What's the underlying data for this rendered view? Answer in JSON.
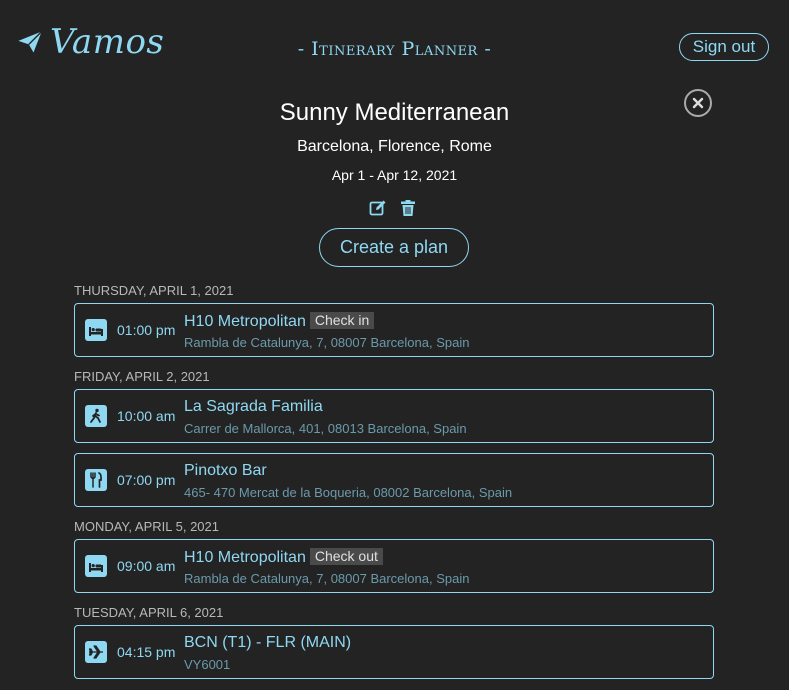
{
  "header": {
    "brand": "Vamos",
    "subtitle": "- Itinerary Planner -",
    "sign_out_label": "Sign out"
  },
  "trip": {
    "title": "Sunny Mediterranean",
    "cities": "Barcelona, Florence, Rome",
    "dates": "Apr 1 - Apr 12, 2021",
    "create_plan_label": "Create a plan"
  },
  "colors": {
    "accent": "#8fd8f2",
    "background": "#232323",
    "badge_bg": "#4a4a4a"
  },
  "days": [
    {
      "label": "Thursday, April 1, 2021",
      "events": [
        {
          "icon": "hotel-icon",
          "time": "01:00 pm",
          "name": "H10 Metropolitan",
          "badge": "Check in",
          "address": "Rambla de Catalunya, 7, 08007 Barcelona, Spain"
        }
      ]
    },
    {
      "label": "Friday, April 2, 2021",
      "events": [
        {
          "icon": "activity-icon",
          "time": "10:00 am",
          "name": "La Sagrada Familia",
          "badge": "",
          "address": "Carrer de Mallorca, 401, 08013 Barcelona, Spain"
        },
        {
          "icon": "restaurant-icon",
          "time": "07:00 pm",
          "name": "Pinotxo Bar",
          "badge": "",
          "address": "465- 470 Mercat de la Boqueria, 08002 Barcelona, Spain"
        }
      ]
    },
    {
      "label": "Monday, April 5, 2021",
      "events": [
        {
          "icon": "hotel-icon",
          "time": "09:00 am",
          "name": "H10 Metropolitan",
          "badge": "Check out",
          "address": "Rambla de Catalunya, 7, 08007 Barcelona, Spain"
        }
      ]
    },
    {
      "label": "Tuesday, April 6, 2021",
      "events": [
        {
          "icon": "flight-icon",
          "time": "04:15 pm",
          "name": "BCN (T1) - FLR (MAIN)",
          "badge": "",
          "address": "VY6001"
        }
      ]
    }
  ]
}
